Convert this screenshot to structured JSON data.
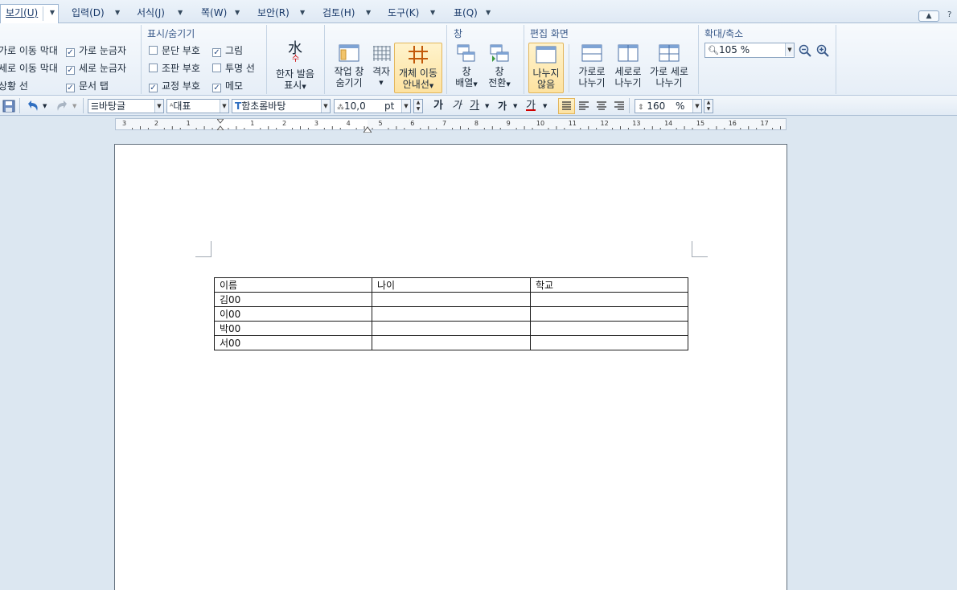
{
  "menu": {
    "tabs": [
      {
        "label": "보기(U)"
      },
      {
        "label": "입력(D)"
      },
      {
        "label": "서식(J)"
      },
      {
        "label": "쪽(W)"
      },
      {
        "label": "보안(R)"
      },
      {
        "label": "검토(H)"
      },
      {
        "label": "도구(K)"
      },
      {
        "label": "표(Q)"
      }
    ],
    "collapse_icon": "chevron-up-icon",
    "help_label": "?"
  },
  "ribbon": {
    "view_items": {
      "h_scroll": "가로 이동 막대",
      "v_scroll": "세로 이동 막대",
      "status_line": "상황 선",
      "h_ruler": "가로 눈금자",
      "v_ruler": "세로 눈금자",
      "doc_tab": "문서 탭"
    },
    "show_hide": {
      "title": "표시/숨기기",
      "paragraph_mark": "문단 부호",
      "object_mark": "조판 부호",
      "proof_mark": "교정 부호",
      "picture": "그림",
      "transparent_line": "투명 선",
      "memo": "메모"
    },
    "hanja": {
      "icon_char": "水",
      "icon_sub": "수",
      "line1": "한자 발음",
      "line2": "표시"
    },
    "task_pane": {
      "line1": "작업 창",
      "line2": "숨기기"
    },
    "grid": {
      "line1": "격자"
    },
    "object_guide": {
      "line1": "개체 이동",
      "line2": "안내선"
    },
    "window_group": {
      "title": "창",
      "arrange_line1": "창",
      "arrange_line2": "배열",
      "switch_line1": "창",
      "switch_line2": "전환"
    },
    "edit_view": {
      "title": "편집 화면",
      "no_split_line1": "나누지",
      "no_split_line2": "않음",
      "h_split_line1": "가로로",
      "h_split_line2": "나누기",
      "v_split_line1": "세로로",
      "v_split_line2": "나누기",
      "hv_split_line1": "가로 세로",
      "hv_split_line2": "나누기"
    },
    "zoom": {
      "title": "확대/축소",
      "value": "105 %"
    }
  },
  "format_bar": {
    "style": "바탕글",
    "language": "대표",
    "font": "함초롬바탕",
    "size_value": "10,0",
    "size_unit": "pt",
    "bold": "가",
    "italic": "가",
    "underline": "가",
    "strike": "가",
    "font_color": "가",
    "line_spacing_value": "160",
    "line_spacing_unit": "%"
  },
  "ruler": {
    "numbers": [
      "3",
      "2",
      "1",
      "1",
      "2",
      "3",
      "4",
      "5",
      "6",
      "7",
      "8",
      "9",
      "10",
      "11",
      "12",
      "13",
      "14",
      "15",
      "16",
      "17"
    ]
  },
  "document": {
    "table": {
      "rows": [
        [
          "이름",
          "나이",
          "학교"
        ],
        [
          "김00",
          "",
          ""
        ],
        [
          "이00",
          "",
          ""
        ],
        [
          "박00",
          "",
          ""
        ],
        [
          "서00",
          "",
          ""
        ]
      ]
    }
  }
}
